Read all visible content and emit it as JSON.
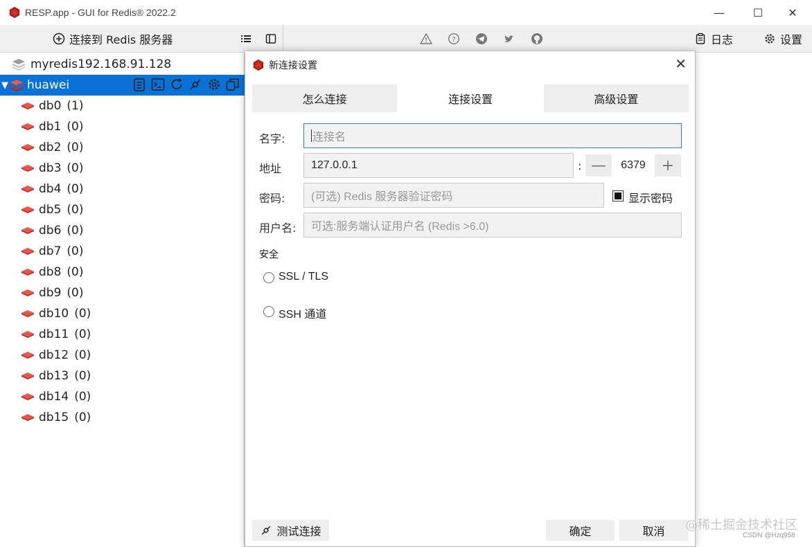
{
  "window": {
    "title": "RESP.app - GUI for Redis® 2022.2",
    "minimize": "—",
    "maximize": "☐",
    "close": "✕"
  },
  "toolbar": {
    "connect_label": "连接到 Redis 服务器",
    "log_label": "日志",
    "settings_label": "设置"
  },
  "sidebar": {
    "connections": [
      {
        "name": "myredis192.168.91.128"
      },
      {
        "name": "huawei",
        "expanded_marker": "▼"
      }
    ],
    "databases": [
      {
        "name": "db0",
        "count": "(1)"
      },
      {
        "name": "db1",
        "count": "(0)"
      },
      {
        "name": "db2",
        "count": "(0)"
      },
      {
        "name": "db3",
        "count": "(0)"
      },
      {
        "name": "db4",
        "count": "(0)"
      },
      {
        "name": "db5",
        "count": "(0)"
      },
      {
        "name": "db6",
        "count": "(0)"
      },
      {
        "name": "db7",
        "count": "(0)"
      },
      {
        "name": "db8",
        "count": "(0)"
      },
      {
        "name": "db9",
        "count": "(0)"
      },
      {
        "name": "db10",
        "count": "(0)"
      },
      {
        "name": "db11",
        "count": "(0)"
      },
      {
        "name": "db12",
        "count": "(0)"
      },
      {
        "name": "db13",
        "count": "(0)"
      },
      {
        "name": "db14",
        "count": "(0)"
      },
      {
        "name": "db15",
        "count": "(0)"
      }
    ]
  },
  "dialog": {
    "title": "新连接设置",
    "close": "✕",
    "tabs": [
      {
        "label": "怎么连接"
      },
      {
        "label": "连接设置"
      },
      {
        "label": "高级设置"
      }
    ],
    "fields": {
      "name_label": "名字:",
      "name_placeholder": "连接名",
      "address_label": "地址",
      "address_value": "127.0.0.1",
      "port_colon": ":",
      "port_minus": "—",
      "port_value": "6379",
      "port_plus": "+",
      "password_label": "密码:",
      "password_placeholder": "(可选) Redis 服务器验证密码",
      "show_password_label": "显示密码",
      "username_label": "用户名:",
      "username_placeholder": "可选:服务端认证用户名 (Redis >6.0)"
    },
    "security": {
      "heading": "安全",
      "ssl_label": "SSL / TLS",
      "ssh_label": "SSH 通道"
    },
    "buttons": {
      "test_label": "测试连接",
      "ok_label": "确定",
      "cancel_label": "取消"
    }
  },
  "watermark": {
    "text": "@稀土掘金技术社区",
    "sub": "CSDN @Hzq958"
  },
  "colors": {
    "accent": "#0a72d6",
    "redis_red": "#d82c20",
    "focus_border": "#2f7ec4"
  }
}
